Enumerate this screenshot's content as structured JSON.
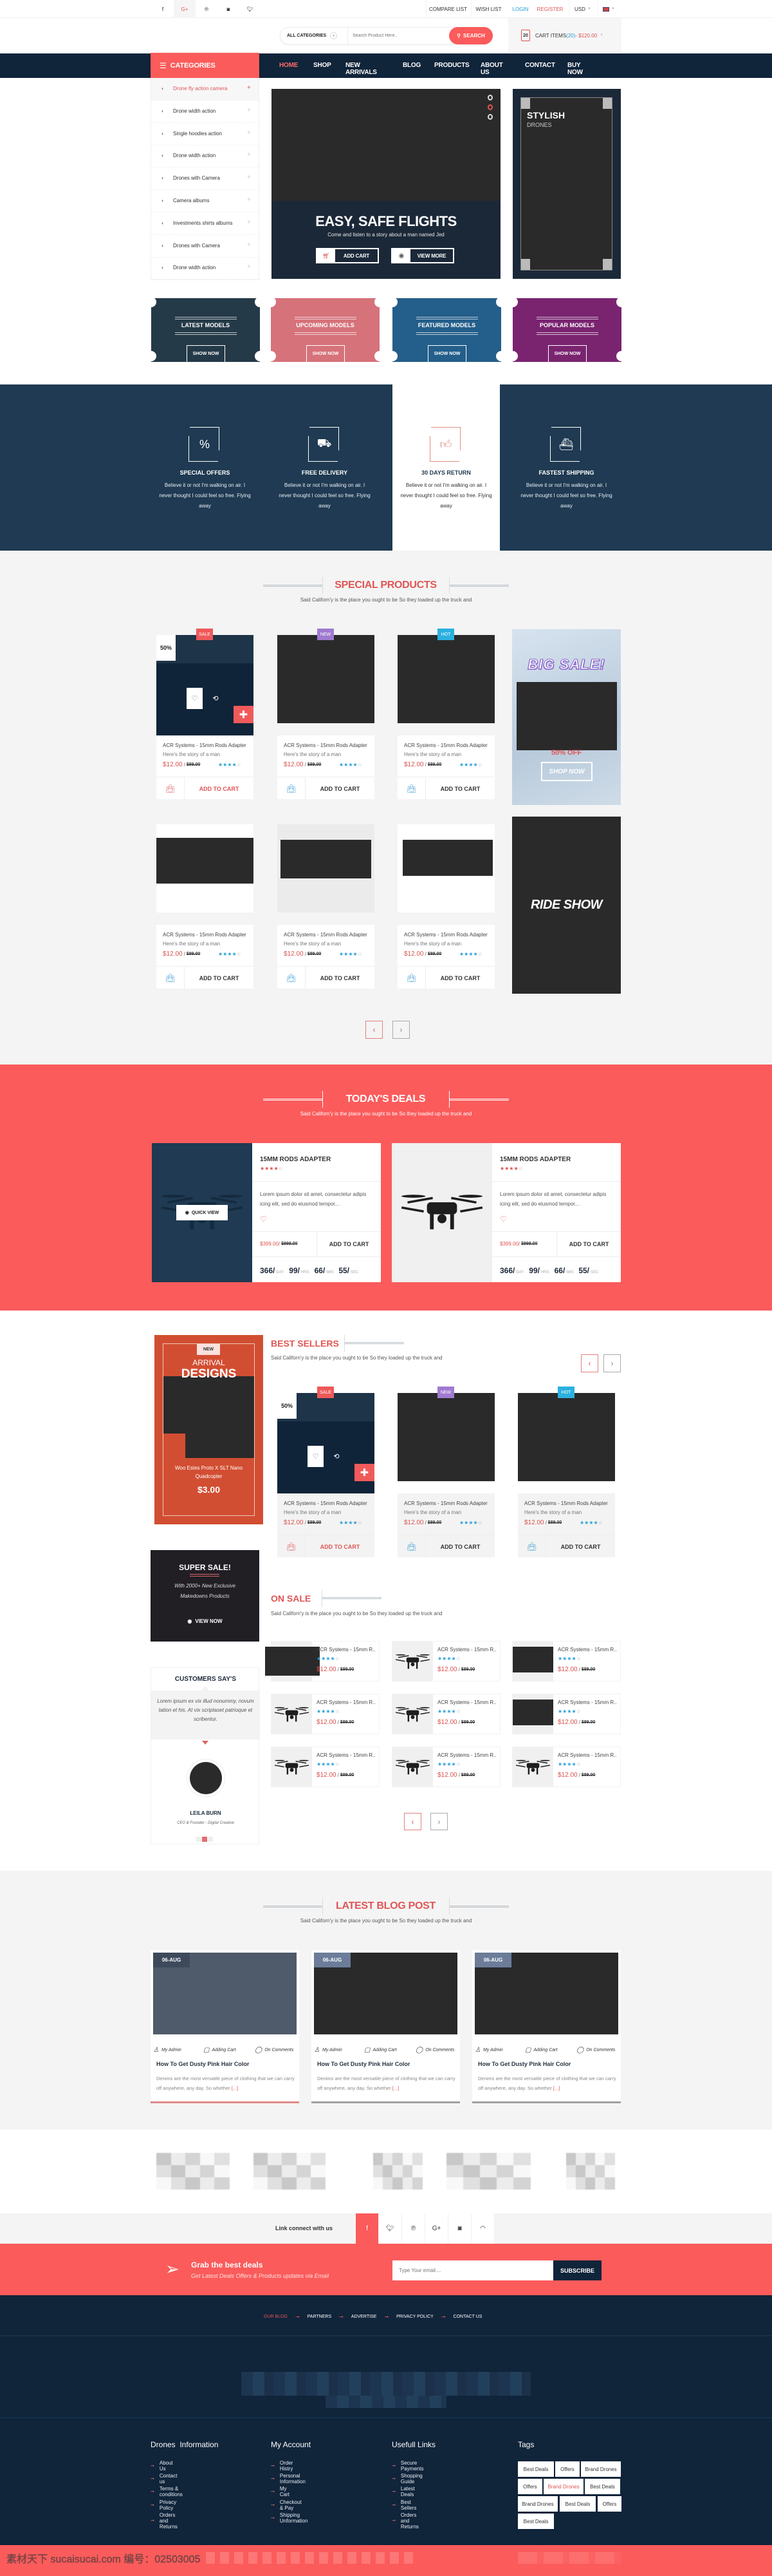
{
  "colors": {
    "brand_red": "#fb5b5b",
    "navy": "#10243a",
    "band_navy": "#1f3a52",
    "heading_red": "#e05555",
    "star_blue": "#2a9fd6",
    "badge_sale": "#f0585a",
    "badge_new": "#a07ad0",
    "badge_hot": "#2bb0e0"
  },
  "topbar": {
    "social": [
      {
        "icon": "facebook-icon"
      },
      {
        "icon": "google-plus-icon"
      },
      {
        "icon": "pinterest-icon"
      },
      {
        "icon": "instagram-icon"
      },
      {
        "icon": "twitter-icon"
      }
    ],
    "compare": "COMPARE LIST",
    "wishlist": "WISH LIST",
    "login": "LOGIN",
    "register": "REGISTER",
    "currency": "USD",
    "language_icon": "uk-flag-icon"
  },
  "header": {
    "category_select": "ALL CATEGORIES",
    "search_placeholder": "Search Product Here..",
    "search_button": "SEARCH",
    "cart_badge": "20",
    "cart_label": "CART ITEMS ",
    "cart_qty": "(20)",
    "cart_total": " - $120.00"
  },
  "nav": {
    "categories_label": "CATEGORIES",
    "items": [
      "HOME",
      "SHOP",
      "NEW ARRIVALS",
      "BLOG",
      "PRODUCTS",
      "ABOUT US",
      "CONTACT",
      "BUY NOW"
    ],
    "active": 0
  },
  "categories": [
    "Drone fly action camera",
    "Drone width action",
    "Single hoodies action",
    "Drone width action",
    "Drones with Camera",
    "Camera albums",
    "Investments shirts albums",
    "Drones with Camera",
    "Drone width action"
  ],
  "hero": {
    "title": "EASY, SAFE FLIGHTS",
    "subtitle": "Come and listen to a story about a  man named Jed",
    "add_cart": "ADD CART",
    "view_more": "VIEW MORE",
    "active_slide": 1,
    "side_title": "STYLISH",
    "side_subtitle": "DRONES"
  },
  "promos": [
    {
      "title": "LATEST MODELS",
      "button": "SHOW NOW",
      "color": "#253a48"
    },
    {
      "title": "UPCOMING MODELS",
      "button": "SHOW NOW",
      "color": "#d6727a"
    },
    {
      "title": "FEATURED MODELS",
      "button": "SHOW NOW",
      "color": "#245e8a"
    },
    {
      "title": "POPULAR MODELS",
      "button": "SHOW NOW",
      "color": "#7a2470"
    }
  ],
  "features": [
    {
      "icon": "percent-badge-icon",
      "title": "SPECIAL OFFERS",
      "text": "Believe it or not I'm walking on air. I never thought I could feel so free. Flying away"
    },
    {
      "icon": "delivery-truck-icon",
      "title": "FREE DELIVERY",
      "text": "Believe it or not I'm walking on air. I never thought I could feel so free. Flying away"
    },
    {
      "icon": "thumbs-up-icon",
      "title": "30 DAYS RETURN",
      "text": "Believe it or not I'm walking on air. I never thought I could feel so free. Flying away",
      "active": true
    },
    {
      "icon": "ship-icon",
      "title": "FASTEST SHIPPING",
      "text": "Believe it or not I'm walking on air. I never thought I could feel so free. Flying away"
    }
  ],
  "special": {
    "title": "SPECIAL PRODUCTS",
    "subtitle": "Said Californ'y is the place you ought to be So they loaded up the truck and",
    "products": [
      {
        "badge": "SALE",
        "discount": "50%",
        "name": "ACR Systems - 15mm Rods Adapter",
        "desc": "Here's the story of a man",
        "price": "$12.00",
        "old_price": "$89.00",
        "rating": 4,
        "add_to_cart": "ADD TO CART",
        "hover": true
      },
      {
        "badge": "NEW",
        "name": "ACR Systems - 15mm Rods Adapter",
        "desc": "Here's the story of a man",
        "price": "$12.00",
        "old_price": "$89.00",
        "rating": 4,
        "add_to_cart": "ADD TO CART"
      },
      {
        "badge": "HOT",
        "name": "ACR Systems - 15mm Rods Adapter",
        "desc": "Here's the story of a man",
        "price": "$12.00",
        "old_price": "$89.00",
        "rating": 4,
        "add_to_cart": "ADD TO CART"
      },
      {
        "name": "ACR Systems - 15mm Rods Adapter",
        "desc": "Here's the story of a man",
        "price": "$12.00",
        "old_price": "$89.00",
        "rating": 4,
        "add_to_cart": "ADD TO CART"
      },
      {
        "name": "ACR Systems - 15mm Rods Adapter",
        "desc": "Here's the story of a man",
        "price": "$12.00",
        "old_price": "$89.00",
        "rating": 4,
        "add_to_cart": "ADD TO CART"
      },
      {
        "name": "ACR Systems - 15mm Rods Adapter",
        "desc": "Here's the story of a man",
        "price": "$12.00",
        "old_price": "$89.00",
        "rating": 4,
        "add_to_cart": "ADD TO CART"
      }
    ],
    "banner_sale": {
      "title": "BIG SALE!",
      "discount": "50% OFF",
      "button": "SHOP NOW"
    },
    "banner_ride": {
      "title": "RIDE SHOW"
    }
  },
  "deals": {
    "title": "TODAY'S DEALS",
    "subtitle": "Said Californ'y is the place you ought to be So they loaded up the truck and",
    "items": [
      {
        "name": "15MM RODS ADAPTER",
        "rating": 4,
        "desc": "Lorem ipsum dolor sit amet, consectetur adipis icing elit, sed do eiusmod tempor...",
        "price": "$399.00/",
        "old_price": "$999.00",
        "add_to_cart": "ADD TO CART",
        "quick_view": "QUICK VIEW",
        "countdown": [
          {
            "value": "366/",
            "unit": "DAY"
          },
          {
            "value": "99/",
            "unit": "HRS"
          },
          {
            "value": "66/",
            "unit": "MIN"
          },
          {
            "value": "55/",
            "unit": "SEC"
          }
        ]
      },
      {
        "name": "15MM RODS ADAPTER",
        "rating": 4,
        "desc": "Lorem ipsum dolor sit amet, consectetur adipis icing elit, sed do eiusmod tempor...",
        "price": "$399.00/",
        "old_price": "$999.00",
        "add_to_cart": "ADD TO CART",
        "countdown": [
          {
            "value": "366/",
            "unit": "DAY"
          },
          {
            "value": "99/",
            "unit": "HRS"
          },
          {
            "value": "66/",
            "unit": "MIN"
          },
          {
            "value": "55/",
            "unit": "SEC"
          }
        ]
      }
    ]
  },
  "arrival": {
    "badge": "NEW",
    "line1": "ARRIVAL",
    "line2": "DESIGNS",
    "product": "Woo Estes Proto X SLT Nano Quadcopter",
    "price": "$3.00"
  },
  "best": {
    "title": "BEST SELLERS",
    "subtitle": "Said Californ'y is the place you ought to be So they loaded up the truck and",
    "products": [
      {
        "badge": "SALE",
        "discount": "50%",
        "name": "ACR Systems - 15mm Rods Adapter",
        "desc": "Here's the story of a man",
        "price": "$12.00",
        "old_price": "$89.00",
        "rating": 4,
        "add_to_cart": "ADD TO CART",
        "hover": true
      },
      {
        "badge": "NEW",
        "name": "ACR Systems - 15mm Rods Adapter",
        "desc": "Here's the story of a man",
        "price": "$12.00",
        "old_price": "$89.00",
        "rating": 4,
        "add_to_cart": "ADD TO CART"
      },
      {
        "badge": "HOT",
        "name": "ACR Systems - 15mm Rods Adapter",
        "desc": "Here's the story of a man",
        "price": "$12.00",
        "old_price": "$89.00",
        "rating": 4,
        "add_to_cart": "ADD TO CART"
      }
    ]
  },
  "super_sale": {
    "title": "SUPER SALE!",
    "text": "With 2000+ New Exclusive Makedowns Products",
    "button": "VIEW NOW"
  },
  "on_sale": {
    "title": "ON SALE",
    "subtitle": "Said Californ'y is the place you ought to be So they loaded up the truck and",
    "items": [
      {
        "image": "placeholder",
        "name": "ACR Systems - 15mm R..",
        "rating": 4,
        "price": "$12.00",
        "old_price": "$89.00"
      },
      {
        "image": "drone",
        "name": "ACR Systems - 15mm R..",
        "rating": 4,
        "price": "$12.00",
        "old_price": "$89.00"
      },
      {
        "image": "placeholder",
        "name": "ACR Systems - 15mm R..",
        "rating": 4,
        "price": "$12.00",
        "old_price": "$89.00"
      },
      {
        "image": "drone",
        "name": "ACR Systems - 15mm R..",
        "rating": 4,
        "price": "$12.00",
        "old_price": "$89.00"
      },
      {
        "image": "drone",
        "name": "ACR Systems - 15mm R..",
        "rating": 4,
        "price": "$12.00",
        "old_price": "$89.00"
      },
      {
        "image": "placeholder",
        "name": "ACR Systems - 15mm R..",
        "rating": 4,
        "price": "$12.00",
        "old_price": "$89.00"
      },
      {
        "image": "drone",
        "name": "ACR Systems - 15mm R..",
        "rating": 4,
        "price": "$12.00",
        "old_price": "$89.00"
      },
      {
        "image": "drone",
        "name": "ACR Systems - 15mm R..",
        "rating": 4,
        "price": "$12.00",
        "old_price": "$89.00"
      },
      {
        "image": "drone",
        "name": "ACR Systems - 15mm R..",
        "rating": 4,
        "price": "$12.00",
        "old_price": "$89.00"
      }
    ]
  },
  "testimonial": {
    "title": "CUSTOMERS SAY'S",
    "quote": "Lorem ipsum ex vix illud nonummy, novum tation et his. At vix scriptaset patrioque et scribentur.",
    "name": "LEILA BURN",
    "role": "CEO & Founder - Digital Creative",
    "active_dot": 1
  },
  "blog": {
    "title": "LATEST BLOG POST",
    "subtitle": "Said Californ'y is the place you ought to be So they loaded up the truck and",
    "posts": [
      {
        "date": "06-AUG",
        "author": "My Admin",
        "cart": "Adding Cart",
        "comments": "On Comments",
        "title": "How To Get Dusty Pink Hair Color",
        "excerpt": "Denims are the most versatile piece of clothing that we can carry off anywhere, any day. So whether ",
        "more": "[...]"
      },
      {
        "date": "06-AUG",
        "author": "My Admin",
        "cart": "Adding Cart",
        "comments": "On Comments",
        "title": "How To Get Dusty Pink Hair Color",
        "excerpt": "Denims are the most versatile piece of clothing that we can carry off anywhere, any day. So whether ",
        "more": "[...]"
      },
      {
        "date": "06-AUG",
        "author": "My Admin",
        "cart": "Adding Cart",
        "comments": "On Comments",
        "title": "How To Get Dusty Pink Hair Color",
        "excerpt": "Denims are the most versatile piece of clothing that we can carry off anywhere, any day. So whether ",
        "more": "[...]"
      }
    ]
  },
  "social": {
    "label": "Link connect with us",
    "icons": [
      "facebook-icon",
      "twitter-icon",
      "pinterest-icon",
      "google-plus-icon",
      "instagram-icon",
      "rss-icon"
    ]
  },
  "newsletter": {
    "title": "Grab the best deals",
    "subtitle": "Get Latest Deals Offers & Products updates via Email",
    "placeholder": "Type Your email....",
    "button": "SUBSCRIBE"
  },
  "footer": {
    "links": [
      "OUR BLOG",
      "PARTNERS",
      "ADVERTISE",
      "PRIVACY POLICY",
      "CONTACT US"
    ],
    "columns": [
      {
        "title": "Drones  Information",
        "items": [
          "About Us",
          "Contact us",
          "Terms & conditions",
          "Privacy Policy",
          "Orders and Returns"
        ]
      },
      {
        "title": "My Account",
        "items": [
          "Order Histry",
          "Personal Information",
          "My Cart",
          "Checkout & Pay",
          "Shipping Unformation"
        ]
      },
      {
        "title": "Usefull Links",
        "items": [
          "Secure Payments",
          "Shopping Guide",
          "Latest Deals",
          "Best Sellers",
          "Orders and Returns"
        ]
      }
    ],
    "tags_title": "Tags",
    "tags": [
      "Best Deals",
      "Offers",
      "Brand Drones",
      "Offers",
      "Brand Drones",
      "Best Deals",
      "Brand Drones",
      "Best Deals",
      "Offers",
      "Best Deals"
    ],
    "active_tag": 4
  },
  "watermark": "素材天下 sucaisucai.com  编号：02503005"
}
